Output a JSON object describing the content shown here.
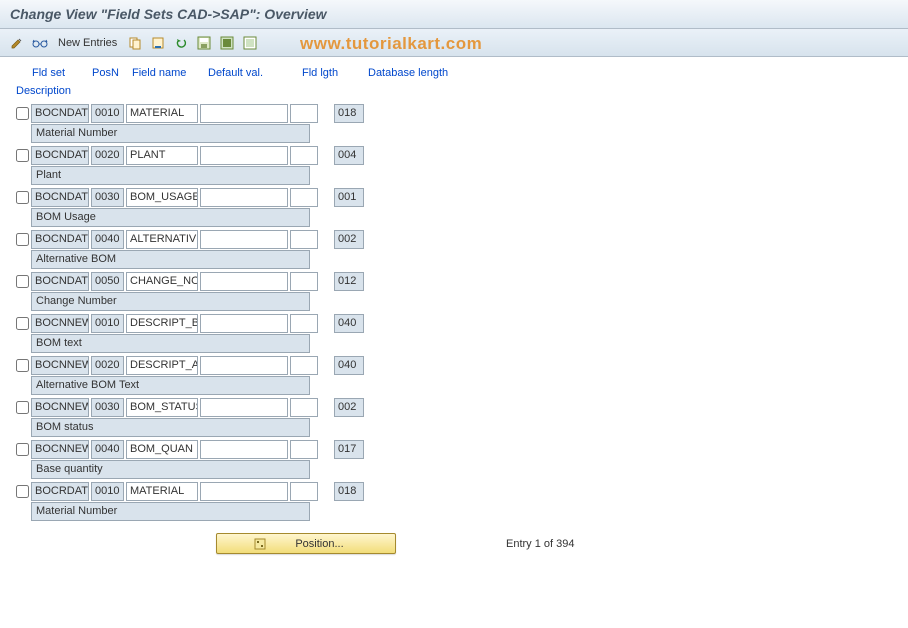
{
  "title": "Change View \"Field Sets CAD->SAP\": Overview",
  "watermark": "www.tutorialkart.com",
  "toolbar": {
    "new_entries_label": "New Entries"
  },
  "columns": {
    "fld_set": "Fld set",
    "posn": "PosN",
    "field_name": "Field name",
    "default_val": "Default val.",
    "fld_lgth": "Fld lgth",
    "db_length": "Database length",
    "description": "Description"
  },
  "rows": [
    {
      "fld_set": "BOCNDAT",
      "posn": "0010",
      "field_name": "MATERIAL",
      "default_val": "",
      "fld_lgth": "",
      "db_length": "018",
      "description": "Material Number"
    },
    {
      "fld_set": "BOCNDAT",
      "posn": "0020",
      "field_name": "PLANT",
      "default_val": "",
      "fld_lgth": "",
      "db_length": "004",
      "description": "Plant"
    },
    {
      "fld_set": "BOCNDAT",
      "posn": "0030",
      "field_name": "BOM_USAGE",
      "default_val": "",
      "fld_lgth": "",
      "db_length": "001",
      "description": "BOM Usage"
    },
    {
      "fld_set": "BOCNDAT",
      "posn": "0040",
      "field_name": "ALTERNATIV",
      "default_val": "",
      "fld_lgth": "",
      "db_length": "002",
      "description": "Alternative BOM"
    },
    {
      "fld_set": "BOCNDAT",
      "posn": "0050",
      "field_name": "CHANGE_NO",
      "default_val": "",
      "fld_lgth": "",
      "db_length": "012",
      "description": "Change Number"
    },
    {
      "fld_set": "BOCNNEW",
      "posn": "0010",
      "field_name": "DESCRIPT_B",
      "default_val": "",
      "fld_lgth": "",
      "db_length": "040",
      "description": "BOM text"
    },
    {
      "fld_set": "BOCNNEW",
      "posn": "0020",
      "field_name": "DESCRIPT_A",
      "default_val": "",
      "fld_lgth": "",
      "db_length": "040",
      "description": "Alternative BOM Text"
    },
    {
      "fld_set": "BOCNNEW",
      "posn": "0030",
      "field_name": "BOM_STATUS",
      "default_val": "",
      "fld_lgth": "",
      "db_length": "002",
      "description": "BOM status"
    },
    {
      "fld_set": "BOCNNEW",
      "posn": "0040",
      "field_name": "BOM_QUAN",
      "default_val": "",
      "fld_lgth": "",
      "db_length": "017",
      "description": "Base quantity"
    },
    {
      "fld_set": "BOCRDAT",
      "posn": "0010",
      "field_name": "MATERIAL",
      "default_val": "",
      "fld_lgth": "",
      "db_length": "018",
      "description": "Material Number"
    }
  ],
  "footer": {
    "position_label": "Position...",
    "entry_counter": "Entry 1 of 394"
  }
}
